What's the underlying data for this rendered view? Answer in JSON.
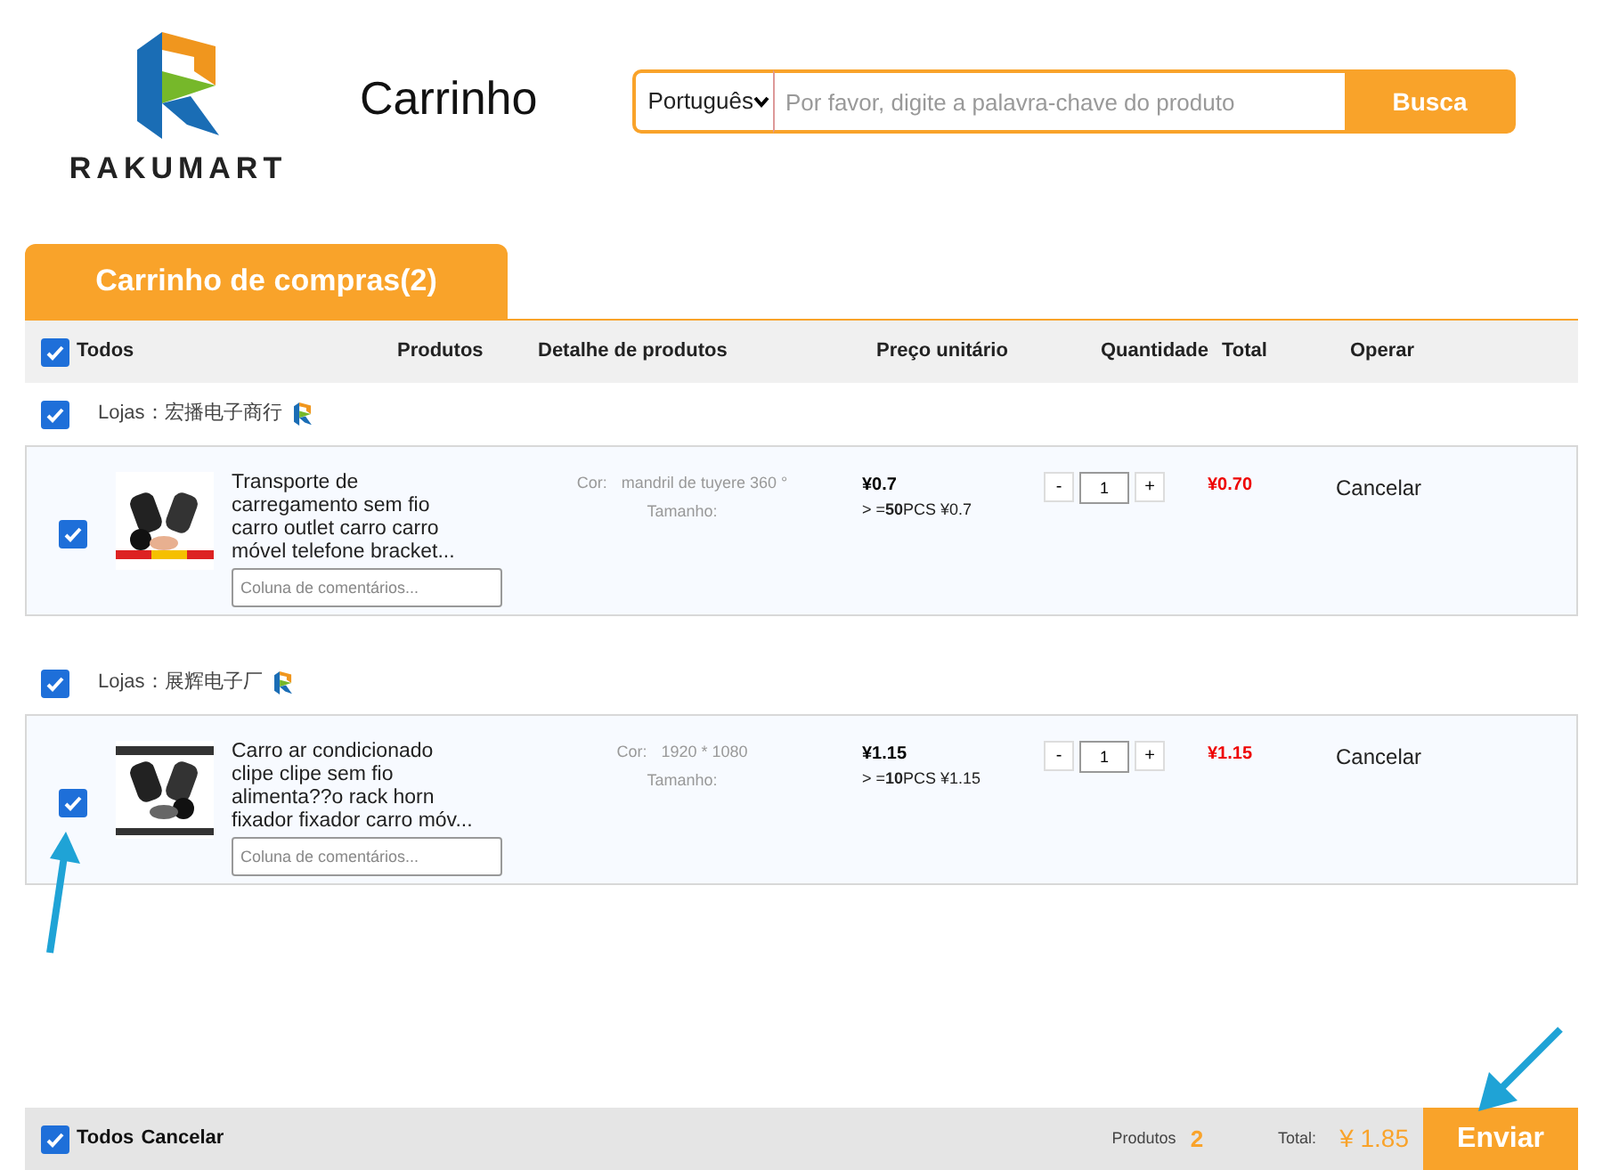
{
  "header": {
    "logo_text": "RAKUMART",
    "page_title": "Carrinho",
    "language": "Português",
    "search_placeholder": "Por favor, digite a palavra-chave do produto",
    "search_button": "Busca"
  },
  "tab": {
    "label": "Carrinho de compras(2)",
    "selected": true
  },
  "table": {
    "select_all": {
      "label": "Todos",
      "checked": true
    },
    "columns": [
      "Produtos",
      "Detalhe de produtos",
      "Preço unitário",
      "Quantidade",
      "Total",
      "Operar"
    ]
  },
  "stores": [
    {
      "label": "Lojas：宏播电子商行",
      "checked": true,
      "items": [
        {
          "checked": true,
          "title": "Transporte de carregamento sem fio carro outlet carro carro móvel telefone bracket...",
          "comment_placeholder": "Coluna de comentários...",
          "color_label": "Cor:",
          "color_value": "mandril de tuyere 360 °",
          "size_label": "Tamanho:",
          "price": "¥0.7",
          "tier": "> =**50**PCS ¥0.7",
          "minus": "-",
          "quantity": "1",
          "plus": "+",
          "total": "¥0.70",
          "action": "Cancelar"
        }
      ]
    },
    {
      "label": "Lojas：展辉电子厂",
      "checked": true,
      "items": [
        {
          "checked": true,
          "title": "Carro ar condicionado clipe clipe sem fio alimenta??o rack horn fixador fixador carro móv...",
          "comment_placeholder": "Coluna de comentários...",
          "color_label": "Cor:",
          "color_value": "1920 * 1080",
          "size_label": "Tamanho:",
          "price": "¥1.15",
          "tier": "> =**10**PCS ¥1.15",
          "minus": "-",
          "quantity": "1",
          "plus": "+",
          "total": "¥1.15",
          "action": "Cancelar"
        }
      ]
    }
  ],
  "footer": {
    "select_all": {
      "label": "Todos",
      "checked": true
    },
    "cancel": "Cancelar",
    "products_label": "Produtos",
    "products_count": "2",
    "total_label": "Total:",
    "total_value": "¥ 1.85",
    "submit": "Enviar"
  }
}
